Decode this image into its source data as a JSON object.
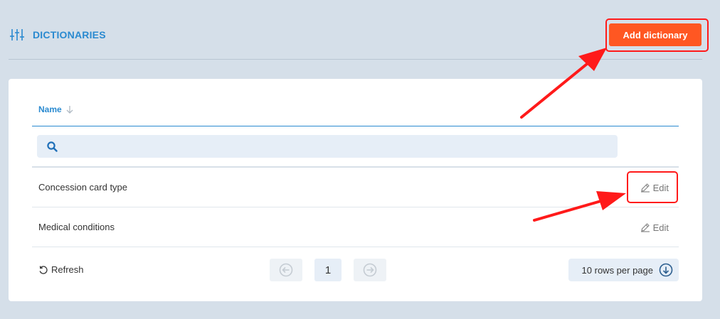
{
  "header": {
    "title": "DICTIONARIES",
    "icon": "sliders-icon",
    "add_button_label": "Add dictionary"
  },
  "table": {
    "column_header": "Name",
    "sort_icon": "arrow-down-icon",
    "search_placeholder": "",
    "rows": [
      {
        "name": "Concession card type",
        "edit_label": "Edit"
      },
      {
        "name": "Medical conditions",
        "edit_label": "Edit"
      }
    ]
  },
  "footer": {
    "refresh_label": "Refresh",
    "current_page": "1",
    "rows_per_page_label": "10 rows per page"
  },
  "colors": {
    "background": "#d5dfe9",
    "accent": "#2a8ad0",
    "primary_button": "#ff5722",
    "annotation": "#ff1a1a"
  }
}
